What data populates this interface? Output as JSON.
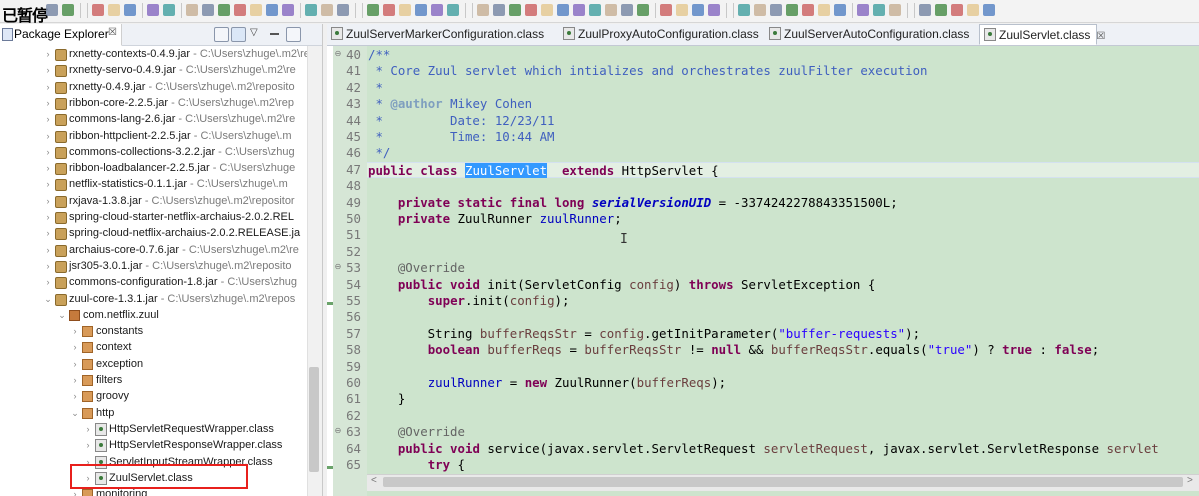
{
  "overlay_text": "已暂停",
  "package_explorer": {
    "title": "Package Explorer",
    "close": "☒",
    "tree": [
      {
        "kind": "jar",
        "label": "rxnetty-contexts-0.4.9.jar",
        "path": " - C:\\Users\\zhuge\\.m2\\re"
      },
      {
        "kind": "jar",
        "label": "rxnetty-servo-0.4.9.jar",
        "path": " - C:\\Users\\zhuge\\.m2\\re"
      },
      {
        "kind": "jar",
        "label": "rxnetty-0.4.9.jar",
        "path": " - C:\\Users\\zhuge\\.m2\\reposito"
      },
      {
        "kind": "jar",
        "label": "ribbon-core-2.2.5.jar",
        "path": " - C:\\Users\\zhuge\\.m2\\rep"
      },
      {
        "kind": "jar",
        "label": "commons-lang-2.6.jar",
        "path": " - C:\\Users\\zhuge\\.m2\\re"
      },
      {
        "kind": "jar",
        "label": "ribbon-httpclient-2.2.5.jar",
        "path": " - C:\\Users\\zhuge\\.m"
      },
      {
        "kind": "jar",
        "label": "commons-collections-3.2.2.jar",
        "path": " - C:\\Users\\zhug"
      },
      {
        "kind": "jar",
        "label": "ribbon-loadbalancer-2.2.5.jar",
        "path": " - C:\\Users\\zhuge"
      },
      {
        "kind": "jar",
        "label": "netflix-statistics-0.1.1.jar",
        "path": " - C:\\Users\\zhuge\\.m"
      },
      {
        "kind": "jar",
        "label": "rxjava-1.3.8.jar",
        "path": " - C:\\Users\\zhuge\\.m2\\repositor"
      },
      {
        "kind": "jar",
        "label": "spring-cloud-starter-netflix-archaius-2.0.2.REL",
        "path": ""
      },
      {
        "kind": "jar",
        "label": "spring-cloud-netflix-archaius-2.0.2.RELEASE.ja",
        "path": ""
      },
      {
        "kind": "jar",
        "label": "archaius-core-0.7.6.jar",
        "path": " - C:\\Users\\zhuge\\.m2\\re"
      },
      {
        "kind": "jar",
        "label": "jsr305-3.0.1.jar",
        "path": " - C:\\Users\\zhuge\\.m2\\reposito"
      },
      {
        "kind": "jar",
        "label": "commons-configuration-1.8.jar",
        "path": " - C:\\Users\\zhug"
      },
      {
        "kind": "jar-open",
        "label": "zuul-core-1.3.1.jar",
        "path": " - C:\\Users\\zhuge\\.m2\\repos"
      },
      {
        "kind": "pkg-open",
        "label": "com.netflix.zuul",
        "path": ""
      },
      {
        "kind": "sub",
        "label": "constants",
        "path": ""
      },
      {
        "kind": "sub",
        "label": "context",
        "path": ""
      },
      {
        "kind": "sub",
        "label": "exception",
        "path": ""
      },
      {
        "kind": "sub",
        "label": "filters",
        "path": ""
      },
      {
        "kind": "sub",
        "label": "groovy",
        "path": ""
      },
      {
        "kind": "sub-open",
        "label": "http",
        "path": ""
      },
      {
        "kind": "cls",
        "label": "HttpServletRequestWrapper.class",
        "path": ""
      },
      {
        "kind": "cls",
        "label": "HttpServletResponseWrapper.class",
        "path": ""
      },
      {
        "kind": "cls",
        "label": "ServletInputStreamWrapper.class",
        "path": ""
      },
      {
        "kind": "cls",
        "label": "ZuulServlet.class",
        "path": ""
      },
      {
        "kind": "sub",
        "label": "monitoring",
        "path": ""
      }
    ]
  },
  "editor": {
    "tabs": [
      {
        "label": "ZuulServerMarkerConfiguration.class",
        "active": false
      },
      {
        "label": "ZuulProxyAutoConfiguration.class",
        "active": false
      },
      {
        "label": "ZuulServerAutoConfiguration.class",
        "active": false
      },
      {
        "label": "ZuulServlet.class",
        "active": true
      }
    ],
    "tab_close": "☒",
    "lines": [
      {
        "n": "40",
        "parts": [
          [
            "cm",
            "/**"
          ]
        ]
      },
      {
        "n": "41",
        "parts": [
          [
            "cm",
            " * Core Zuul servlet which intializes and orchestrates zuulFilter execution"
          ]
        ]
      },
      {
        "n": "42",
        "parts": [
          [
            "cm",
            " *"
          ]
        ]
      },
      {
        "n": "43",
        "parts": [
          [
            "cm",
            " * "
          ],
          [
            "tag",
            "@author"
          ],
          [
            "cm",
            " Mikey Cohen"
          ]
        ]
      },
      {
        "n": "44",
        "parts": [
          [
            "cm",
            " *         Date: 12/23/11"
          ]
        ]
      },
      {
        "n": "45",
        "parts": [
          [
            "cm",
            " *         Time: 10:44 AM"
          ]
        ]
      },
      {
        "n": "46",
        "parts": [
          [
            "cm",
            " */"
          ]
        ]
      },
      {
        "n": "47",
        "parts": [
          [
            "kw",
            "public class "
          ],
          [
            "sel",
            "ZuulServlet"
          ],
          [
            "",
            "  "
          ],
          [
            "kw",
            "extends"
          ],
          [
            "",
            " HttpServlet {"
          ]
        ],
        "current": true
      },
      {
        "n": "48",
        "parts": []
      },
      {
        "n": "49",
        "parts": [
          [
            "",
            "    "
          ],
          [
            "kw",
            "private static final long "
          ],
          [
            "sfld",
            "serialVersionUID"
          ],
          [
            "",
            " = -3374242278843351500L;"
          ]
        ]
      },
      {
        "n": "50",
        "parts": [
          [
            "",
            "    "
          ],
          [
            "kw",
            "private"
          ],
          [
            "",
            " ZuulRunner "
          ],
          [
            "fld",
            "zuulRunner"
          ],
          [
            ";"
          ]
        ]
      },
      {
        "n": "51",
        "parts": []
      },
      {
        "n": "52",
        "parts": []
      },
      {
        "n": "53",
        "parts": [
          [
            "",
            "    "
          ],
          [
            "ann",
            "@Override"
          ]
        ]
      },
      {
        "n": "54",
        "parts": [
          [
            "",
            "    "
          ],
          [
            "kw",
            "public void"
          ],
          [
            "",
            " init(ServletConfig "
          ],
          [
            "param",
            "config"
          ],
          [
            ") "
          ],
          [
            "kw",
            "throws"
          ],
          [
            "",
            " ServletException {"
          ]
        ]
      },
      {
        "n": "55",
        "parts": [
          [
            "",
            "        "
          ],
          [
            "kw",
            "super"
          ],
          [
            ".init("
          ],
          [
            "param",
            "config"
          ],
          [
            ");"
          ]
        ]
      },
      {
        "n": "56",
        "parts": []
      },
      {
        "n": "57",
        "parts": [
          [
            "",
            "        String "
          ],
          [
            "param",
            "bufferReqsStr"
          ],
          [
            "",
            " = "
          ],
          [
            "param",
            "config"
          ],
          [
            ".getInitParameter("
          ],
          [
            "str",
            "\"buffer-requests\""
          ],
          [
            ");"
          ]
        ]
      },
      {
        "n": "58",
        "parts": [
          [
            "",
            "        "
          ],
          [
            "kw",
            "boolean "
          ],
          [
            "param",
            "bufferReqs"
          ],
          [
            "",
            " = "
          ],
          [
            "param",
            "bufferReqsStr"
          ],
          [
            "",
            " != "
          ],
          [
            "kw",
            "null"
          ],
          [
            " && "
          ],
          [
            "param",
            "bufferReqsStr"
          ],
          [
            ".equals("
          ],
          [
            "str",
            "\"true\""
          ],
          [
            ") ? "
          ],
          [
            "kw",
            "true"
          ],
          [
            " : "
          ],
          [
            "kw",
            "false"
          ],
          [
            ";"
          ]
        ]
      },
      {
        "n": "59",
        "parts": []
      },
      {
        "n": "60",
        "parts": [
          [
            "",
            "        "
          ],
          [
            "fld",
            "zuulRunner"
          ],
          [
            "",
            " = "
          ],
          [
            "kw",
            "new"
          ],
          [
            "",
            " ZuulRunner("
          ],
          [
            "param",
            "bufferReqs"
          ],
          [
            ");"
          ]
        ]
      },
      {
        "n": "61",
        "parts": [
          [
            "",
            "    }"
          ]
        ]
      },
      {
        "n": "62",
        "parts": []
      },
      {
        "n": "63",
        "parts": [
          [
            "",
            "    "
          ],
          [
            "ann",
            "@Override"
          ]
        ]
      },
      {
        "n": "64",
        "parts": [
          [
            "",
            "    "
          ],
          [
            "kw",
            "public void"
          ],
          [
            "",
            " service(javax.servlet.ServletRequest "
          ],
          [
            "param",
            "servletRequest"
          ],
          [
            ", javax.servlet.ServletResponse "
          ],
          [
            "param",
            "servlet"
          ]
        ]
      },
      {
        "n": "65",
        "parts": [
          [
            "",
            "        "
          ],
          [
            "kw",
            "try"
          ],
          [
            " {"
          ]
        ]
      }
    ]
  },
  "colors": {
    "editor_bg": "#cde4cd",
    "highlight_box": "#e8201c",
    "selection": "#3399ff"
  }
}
